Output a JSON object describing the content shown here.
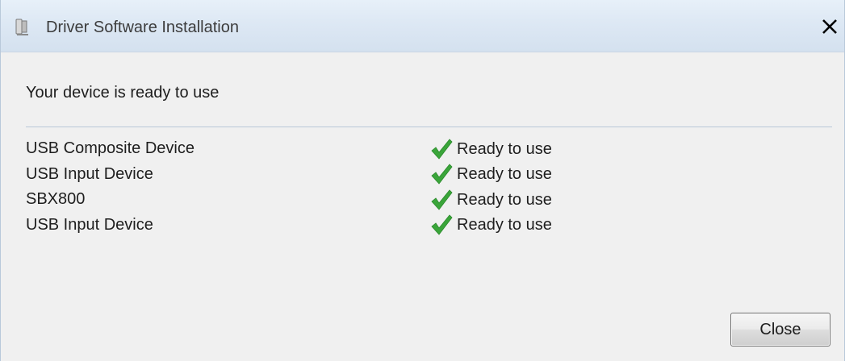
{
  "window": {
    "title": "Driver Software Installation",
    "title_icon": "usb-device-icon",
    "close_icon": "close-x-icon"
  },
  "content": {
    "headline": "Your device is ready to use",
    "devices": [
      {
        "name": "USB Composite Device",
        "status": "Ready to use",
        "status_icon": "green-check-icon"
      },
      {
        "name": "USB Input Device",
        "status": "Ready to use",
        "status_icon": "green-check-icon"
      },
      {
        "name": "SBX800",
        "status": "Ready to use",
        "status_icon": "green-check-icon"
      },
      {
        "name": "USB Input Device",
        "status": "Ready to use",
        "status_icon": "green-check-icon"
      }
    ]
  },
  "footer": {
    "close_label": "Close"
  },
  "colors": {
    "titlebar": "#dde8f4",
    "background": "#f0f0f0",
    "check": "#3aa53a",
    "divider": "#b8c8d8"
  }
}
